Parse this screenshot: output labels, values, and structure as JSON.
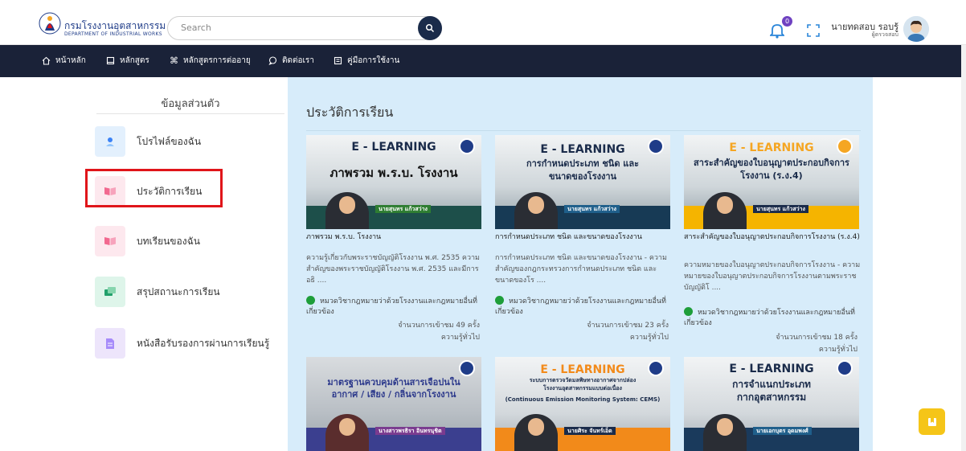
{
  "header": {
    "brand_th": "กรมโรงงานอุตสาหกรรม",
    "brand_en": "DEPARTMENT OF INDUSTRIAL WORKS",
    "search_placeholder": "Search",
    "notification_count": "0",
    "user_name": "นายทดสอบ รอบรู้",
    "user_role": "ผู้ตรวจสอบ"
  },
  "nav": {
    "items": [
      {
        "label": "หน้าหลัก",
        "icon": "home-icon"
      },
      {
        "label": "หลักสูตร",
        "icon": "book-icon"
      },
      {
        "label": "หลักสูตรการต่ออายุ",
        "icon": "command-icon"
      },
      {
        "label": "ติดต่อเรา",
        "icon": "chat-icon"
      },
      {
        "label": "คู่มือการใช้งาน",
        "icon": "manual-icon"
      }
    ]
  },
  "sidebar": {
    "heading": "ข้อมูลส่วนตัว",
    "items": [
      {
        "label": "โปรไฟล์ของฉัน",
        "icon": "profile-icon",
        "color": "#3b82f6"
      },
      {
        "label": "ประวัติการเรียน",
        "icon": "book-open-icon",
        "color": "#f2688f"
      },
      {
        "label": "บทเรียนของฉัน",
        "icon": "book-open-icon",
        "color": "#f2688f"
      },
      {
        "label": "สรุปสถานะการเรียน",
        "icon": "chat-icon",
        "color": "#22a06b"
      },
      {
        "label": "หนังสือรับรองการผ่านการเรียนรู้",
        "icon": "document-icon",
        "color": "#7c3aed"
      }
    ]
  },
  "main": {
    "title": "ประวัติการเรียน",
    "courses": [
      {
        "banner_label": "E - LEARNING",
        "banner_title": "ภาพรวม พ.ร.บ. โรงงาน",
        "banner_name": "นายสุนทร แก้วสว่าง",
        "title": "ภาพรวม พ.ร.บ. โรงงาน",
        "description": "ความรู้เกี่ยวกับพระราชบัญญัติโรงงาน พ.ศ. 2535 ความสำคัญของพระราชบัญญัติโรงงาน พ.ศ. 2535 และมีการอธิ ....",
        "category": "หมวดวิชากฎหมายว่าด้วยโรงงานและกฎหมายอื่นที่เกี่ยวข้อง",
        "views": "จำนวนการเข้าชม 49 ครั้ง",
        "level": "ความรู้ทั่วไป"
      },
      {
        "banner_label": "E - LEARNING",
        "banner_title": "การกำหนดประเภท ชนิด และขนาดของโรงงาน",
        "banner_name": "นายสุนทร แก้วสว่าง",
        "title": "การกำหนดประเภท ชนิด และขนาดของโรงงาน",
        "description": "การกำหนดประเภท ชนิด และขนาดของโรงงาน - ความสำคัญของกฎกระทรวงการกำหนดประเภท ชนิด และขนาดของโร ....",
        "category": "หมวดวิชากฎหมายว่าด้วยโรงงานและกฎหมายอื่นที่เกี่ยวข้อง",
        "views": "จำนวนการเข้าชม 23 ครั้ง",
        "level": "ความรู้ทั่วไป"
      },
      {
        "banner_label": "E - LEARNING",
        "banner_title": "สาระสำคัญของใบอนุญาตประกอบกิจการโรงงาน (ร.ง.4)",
        "banner_name": "นายสุนทร แก้วสว่าง",
        "title": "สาระสำคัญของใบอนุญาตประกอบกิจการโรงงาน (ร.ง.4)",
        "description": "ความหมายของใบอนุญาตประกอบกิจการโรงงาน - ความหมายของใบอนุญาตประกอบกิจการโรงงานตามพระราชบัญญัติโ ....",
        "category": "หมวดวิชากฎหมายว่าด้วยโรงงานและกฎหมายอื่นที่เกี่ยวข้อง",
        "views": "จำนวนการเข้าชม 18 ครั้ง",
        "level": "ความรู้ทั่วไป"
      },
      {
        "banner_label": "",
        "banner_title": "มาตรฐานควบคุมด้านสารเจือปนในอากาศ / เสียง / กลิ่นจากโรงงาน",
        "banner_name": "นางสาวพรธิรา อินทรนุชิต"
      },
      {
        "banner_label": "E - LEARNING",
        "banner_title": "ระบบการตรวจวัดมลพิษทางอากาศจากปล่องโรงงานอุตสาหกรรมแบบต่อเนื่อง",
        "banner_subtitle": "(Continuous Emission Monitoring System: CEMS)",
        "banner_name": "นายศิระ จันทร์เอ็ด"
      },
      {
        "banner_label": "E - LEARNING",
        "banner_title": "การจำแนกประเภทกากอุตสาหกรรม",
        "banner_name": "นายเอกบุตร อุดมพงศ์"
      }
    ]
  },
  "colors": {
    "nav_bg": "#1a2238",
    "content_bg": "#d7ecfa",
    "highlight": "#e0151a",
    "fab": "#f5c518"
  }
}
